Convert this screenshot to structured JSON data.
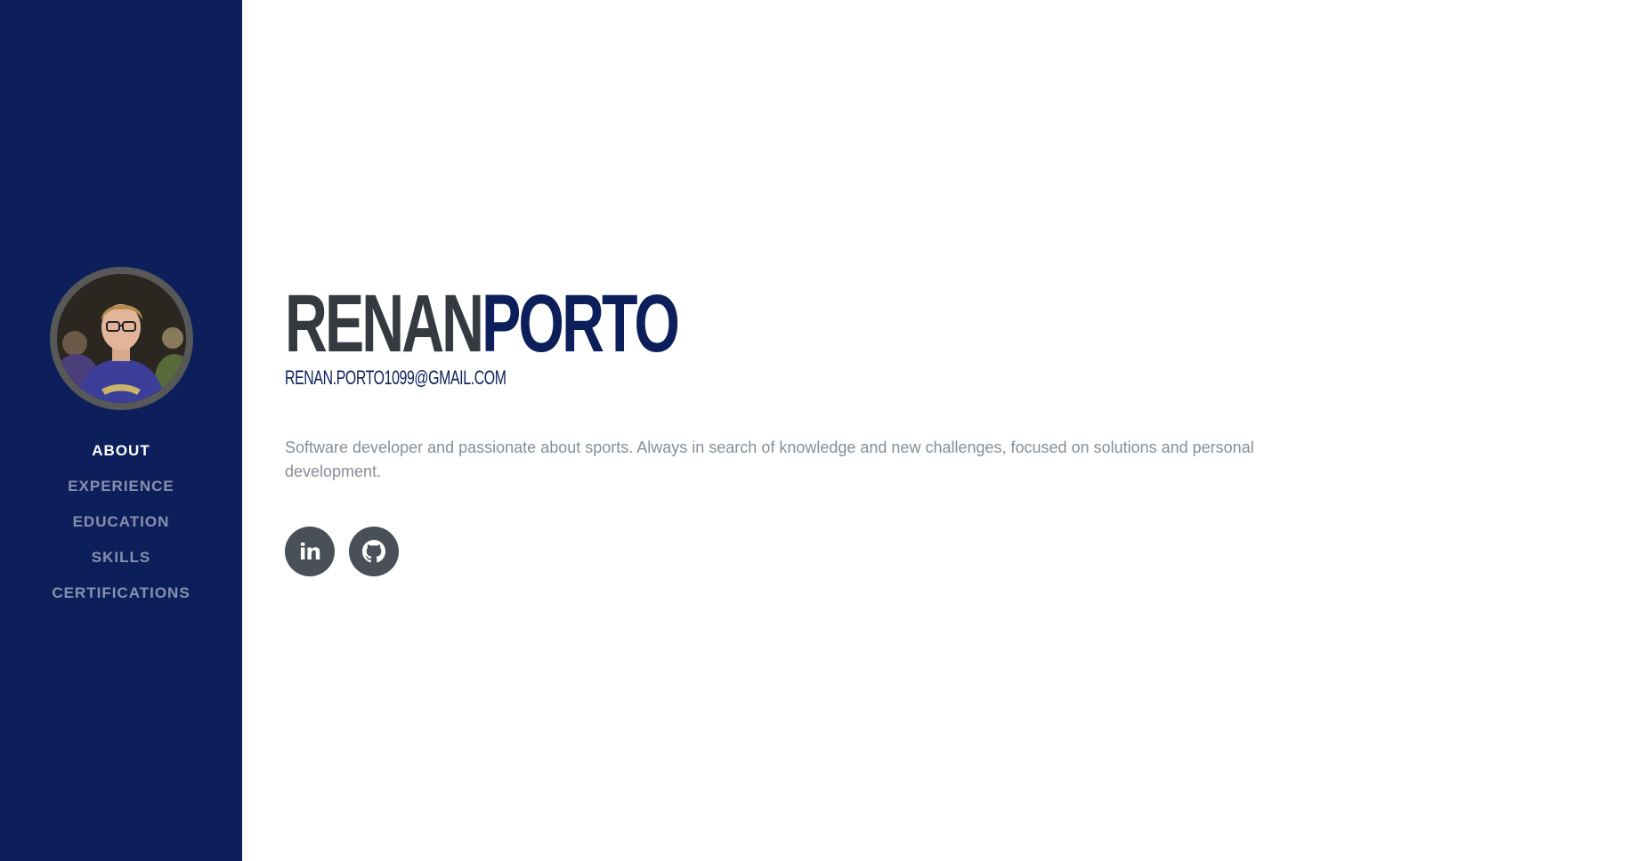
{
  "sidebar": {
    "background": "#0c1f5a",
    "avatar_alt": "",
    "nav": [
      {
        "label": "ABOUT",
        "active": true
      },
      {
        "label": "EXPERIENCE",
        "active": false
      },
      {
        "label": "EDUCATION",
        "active": false
      },
      {
        "label": "SKILLS",
        "active": false
      },
      {
        "label": "CERTIFICATIONS",
        "active": false
      }
    ]
  },
  "profile": {
    "first_name": "RENAN",
    "last_name": "PORTO",
    "email": "RENAN.PORTO1099@GMAIL.COM",
    "bio": "Software developer and passionate about sports. Always in search of knowledge and new challenges, focused on solutions and personal development."
  },
  "social": [
    {
      "icon": "linkedin-icon"
    },
    {
      "icon": "github-icon"
    }
  ],
  "colors": {
    "primary": "#0c1f5a",
    "heading": "#343a40",
    "text": "#868e96",
    "social_bg": "#495057"
  }
}
